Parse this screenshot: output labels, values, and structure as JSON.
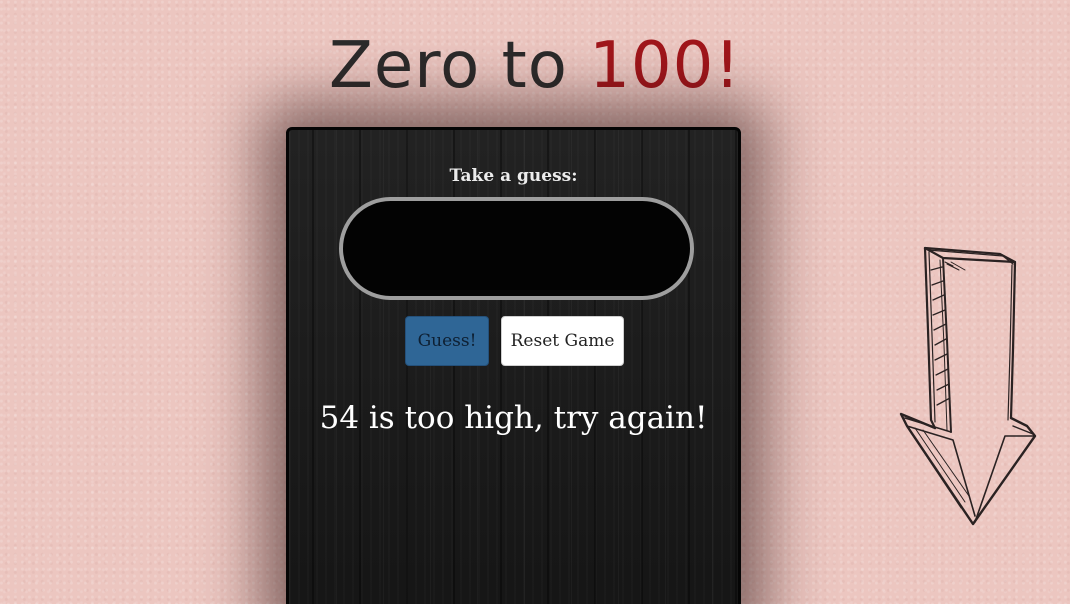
{
  "title": {
    "prefix": "Zero to ",
    "accent": "100!"
  },
  "game": {
    "prompt_label": "Take a guess:",
    "input_value": "",
    "input_placeholder": "",
    "guess_button": "Guess!",
    "reset_button": "Reset Game",
    "feedback": "54 is too high, try again!"
  },
  "decorations": {
    "arrow_icon": "hand-drawn-down-arrow-icon"
  },
  "colors": {
    "background": "#ecc6c0",
    "title_text": "#2b2b2b",
    "title_accent": "#a1161b",
    "board": "#1a1a1a",
    "guess_button": "#2f6696",
    "reset_button": "#ffffff"
  }
}
